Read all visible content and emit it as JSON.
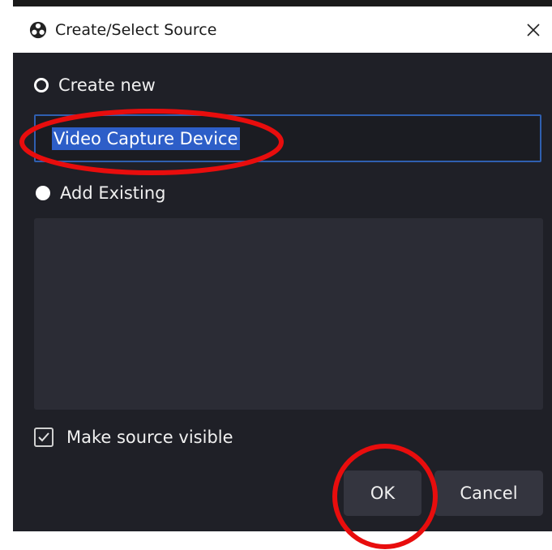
{
  "window": {
    "title": "Create/Select Source",
    "close_icon": "close-icon",
    "logo_icon": "obs-logo-icon"
  },
  "create_new": {
    "label": "Create new",
    "selected": false,
    "input_value": "Video Capture Device"
  },
  "add_existing": {
    "label": "Add Existing",
    "selected": true,
    "items": []
  },
  "make_visible": {
    "label": "Make source visible",
    "checked": true
  },
  "buttons": {
    "ok_label": "OK",
    "cancel_label": "Cancel"
  },
  "colors": {
    "dialog_bg": "#1f2027",
    "input_border": "#2f5fb0",
    "selection_bg": "#2d5ec8",
    "annotation_red": "#e80d0d"
  }
}
